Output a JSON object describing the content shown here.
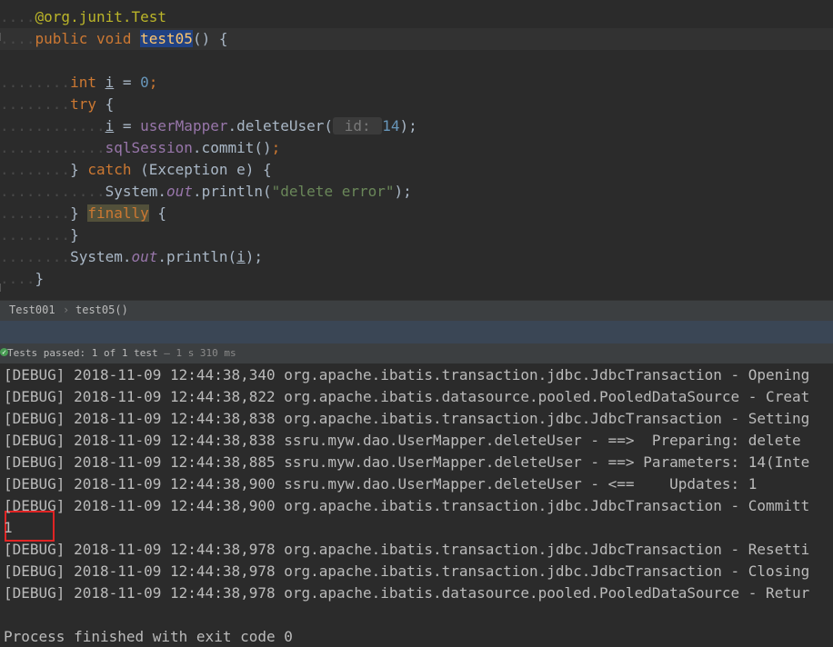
{
  "editor": {
    "lines": [
      {
        "ws": "....",
        "parts": [
          {
            "t": "@org.junit.",
            "c": "ann"
          },
          {
            "t": "Test",
            "c": "ann"
          }
        ]
      },
      {
        "ws": "....",
        "current": true,
        "parts": [
          {
            "t": "public ",
            "c": "kw"
          },
          {
            "t": "void ",
            "c": "kw"
          },
          {
            "t": "test05",
            "c": "hl-method"
          },
          {
            "t": "() {",
            "c": ""
          }
        ]
      },
      {
        "ws": "",
        "parts": []
      },
      {
        "ws": "........",
        "parts": [
          {
            "t": "int ",
            "c": "kw"
          },
          {
            "t": "i",
            "c": "underline"
          },
          {
            "t": " = ",
            "c": ""
          },
          {
            "t": "0",
            "c": "num"
          },
          {
            "t": ";",
            "c": "kw"
          }
        ]
      },
      {
        "ws": "........",
        "parts": [
          {
            "t": "try ",
            "c": "kw"
          },
          {
            "t": "{",
            "c": ""
          }
        ]
      },
      {
        "ws": "............",
        "parts": [
          {
            "t": "i",
            "c": "underline"
          },
          {
            "t": " = ",
            "c": ""
          },
          {
            "t": "userMapper",
            "c": "field"
          },
          {
            "t": ".deleteUser(",
            "c": ""
          },
          {
            "t": " id: ",
            "c": "hint"
          },
          {
            "t": "14",
            "c": "num"
          },
          {
            "t": ");",
            "c": ""
          }
        ]
      },
      {
        "ws": "............",
        "parts": [
          {
            "t": "sqlSession",
            "c": "field"
          },
          {
            "t": ".commit()",
            "c": ""
          },
          {
            "t": ";",
            "c": "kw"
          }
        ]
      },
      {
        "ws": "........",
        "parts": [
          {
            "t": "} ",
            "c": ""
          },
          {
            "t": "catch ",
            "c": "kw"
          },
          {
            "t": "(Exception e) {",
            "c": ""
          }
        ]
      },
      {
        "ws": "............",
        "parts": [
          {
            "t": "System.",
            "c": ""
          },
          {
            "t": "out",
            "c": "static"
          },
          {
            "t": ".println(",
            "c": ""
          },
          {
            "t": "\"delete error\"",
            "c": "str"
          },
          {
            "t": ");",
            "c": ""
          }
        ]
      },
      {
        "ws": "........",
        "parts": [
          {
            "t": "} ",
            "c": ""
          },
          {
            "t": "finally",
            "c": "hl-kw"
          },
          {
            "t": " {",
            "c": ""
          }
        ]
      },
      {
        "ws": "........",
        "parts": [
          {
            "t": "}",
            "c": ""
          }
        ]
      },
      {
        "ws": "........",
        "parts": [
          {
            "t": "System.",
            "c": ""
          },
          {
            "t": "out",
            "c": "static"
          },
          {
            "t": ".println(",
            "c": ""
          },
          {
            "t": "i",
            "c": "underline"
          },
          {
            "t": ");",
            "c": ""
          }
        ]
      },
      {
        "ws": "....",
        "parts": [
          {
            "t": "}",
            "c": ""
          }
        ]
      }
    ]
  },
  "breadcrumb": {
    "class_name": "Test001",
    "method_name": "test05()"
  },
  "status": {
    "label": "Tests passed:",
    "passed_count": "1",
    "of_total": "of 1 test",
    "duration": " – 1 s 310 ms",
    "icon": "check-icon"
  },
  "console": {
    "lines": [
      "[DEBUG] 2018-11-09 12:44:38,340 org.apache.ibatis.transaction.jdbc.JdbcTransaction - Opening",
      "[DEBUG] 2018-11-09 12:44:38,822 org.apache.ibatis.datasource.pooled.PooledDataSource - Creat",
      "[DEBUG] 2018-11-09 12:44:38,838 org.apache.ibatis.transaction.jdbc.JdbcTransaction - Setting",
      "[DEBUG] 2018-11-09 12:44:38,838 ssru.myw.dao.UserMapper.deleteUser - ==>  Preparing: delete",
      "[DEBUG] 2018-11-09 12:44:38,885 ssru.myw.dao.UserMapper.deleteUser - ==> Parameters: 14(Inte",
      "[DEBUG] 2018-11-09 12:44:38,900 ssru.myw.dao.UserMapper.deleteUser - <==    Updates: 1",
      "[DEBUG] 2018-11-09 12:44:38,900 org.apache.ibatis.transaction.jdbc.JdbcTransaction - Committ",
      "1",
      "[DEBUG] 2018-11-09 12:44:38,978 org.apache.ibatis.transaction.jdbc.JdbcTransaction - Resetti",
      "[DEBUG] 2018-11-09 12:44:38,978 org.apache.ibatis.transaction.jdbc.JdbcTransaction - Closing",
      "[DEBUG] 2018-11-09 12:44:38,978 org.apache.ibatis.datasource.pooled.PooledDataSource - Retur",
      "",
      "Process finished with exit code 0"
    ]
  }
}
